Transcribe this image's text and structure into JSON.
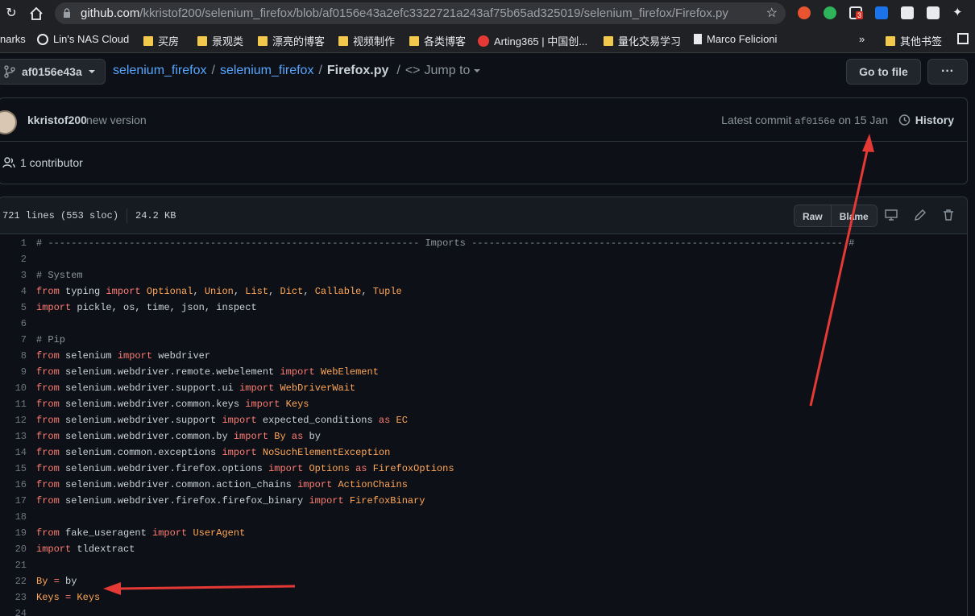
{
  "browser": {
    "url_host": "github.com",
    "url_path": "/kkristof200/selenium_firefox/blob/af0156e43a2efc3322721a243af75b65ad325019/selenium_firefox/Firefox.py",
    "ext_badge": "3",
    "bookmarks": [
      {
        "label": "narks",
        "type": "text"
      },
      {
        "label": "Lin's NAS Cloud",
        "type": "globe"
      },
      {
        "label": "买房",
        "type": "folder"
      },
      {
        "label": "景观类",
        "type": "folder"
      },
      {
        "label": "漂亮的博客",
        "type": "folder"
      },
      {
        "label": "视频制作",
        "type": "folder"
      },
      {
        "label": "各类博客",
        "type": "folder"
      },
      {
        "label": "Arting365 | 中国创...",
        "type": "site"
      },
      {
        "label": "量化交易学习",
        "type": "folder"
      },
      {
        "label": "Marco Felicioni",
        "type": "page"
      },
      {
        "label": "»",
        "type": "more"
      },
      {
        "label": "其他书签",
        "type": "folder"
      }
    ]
  },
  "repo": {
    "branch": "af0156e43a",
    "crumb_repo": "selenium_firefox",
    "crumb_dir": "selenium_firefox",
    "crumb_file": "Firefox.py",
    "jump_to": "Jump to",
    "go_to_file": "Go to file",
    "more": "···"
  },
  "commit": {
    "author": "kkristof200",
    "message": "new version",
    "latest_prefix": "Latest commit",
    "sha": "af0156e",
    "date": "on 15 Jan",
    "history": "History",
    "contributors": "1 contributor"
  },
  "file": {
    "lines_info": "721 lines (553 sloc)",
    "size": "24.2 KB",
    "raw": "Raw",
    "blame": "Blame"
  },
  "code_lines": [
    [
      [
        "cm",
        "# ---------------------------------------------------------------- Imports ---------------------------------------------------------------- #"
      ]
    ],
    [],
    [
      [
        "cm",
        "# System"
      ]
    ],
    [
      [
        "kw",
        "from"
      ],
      [
        "",
        " typing "
      ],
      [
        "kw",
        "import"
      ],
      [
        "",
        " "
      ],
      [
        "cls",
        "Optional"
      ],
      [
        "",
        ", "
      ],
      [
        "cls",
        "Union"
      ],
      [
        "",
        ", "
      ],
      [
        "cls",
        "List"
      ],
      [
        "",
        ", "
      ],
      [
        "cls",
        "Dict"
      ],
      [
        "",
        ", "
      ],
      [
        "cls",
        "Callable"
      ],
      [
        "",
        ", "
      ],
      [
        "cls",
        "Tuple"
      ]
    ],
    [
      [
        "kw",
        "import"
      ],
      [
        "",
        " pickle, os, time, json, inspect"
      ]
    ],
    [],
    [
      [
        "cm",
        "# Pip"
      ]
    ],
    [
      [
        "kw",
        "from"
      ],
      [
        "",
        " selenium "
      ],
      [
        "kw",
        "import"
      ],
      [
        "",
        " webdriver"
      ]
    ],
    [
      [
        "kw",
        "from"
      ],
      [
        "",
        " selenium.webdriver.remote.webelement "
      ],
      [
        "kw",
        "import"
      ],
      [
        "",
        " "
      ],
      [
        "cls",
        "WebElement"
      ]
    ],
    [
      [
        "kw",
        "from"
      ],
      [
        "",
        " selenium.webdriver.support.ui "
      ],
      [
        "kw",
        "import"
      ],
      [
        "",
        " "
      ],
      [
        "cls",
        "WebDriverWait"
      ]
    ],
    [
      [
        "kw",
        "from"
      ],
      [
        "",
        " selenium.webdriver.common.keys "
      ],
      [
        "kw",
        "import"
      ],
      [
        "",
        " "
      ],
      [
        "cls",
        "Keys"
      ]
    ],
    [
      [
        "kw",
        "from"
      ],
      [
        "",
        " selenium.webdriver.support "
      ],
      [
        "kw",
        "import"
      ],
      [
        "",
        " expected_conditions "
      ],
      [
        "kw",
        "as"
      ],
      [
        "",
        " "
      ],
      [
        "cls",
        "EC"
      ]
    ],
    [
      [
        "kw",
        "from"
      ],
      [
        "",
        " selenium.webdriver.common.by "
      ],
      [
        "kw",
        "import"
      ],
      [
        "",
        " "
      ],
      [
        "cls",
        "By"
      ],
      [
        "",
        " "
      ],
      [
        "kw",
        "as"
      ],
      [
        "",
        " by"
      ]
    ],
    [
      [
        "kw",
        "from"
      ],
      [
        "",
        " selenium.common.exceptions "
      ],
      [
        "kw",
        "import"
      ],
      [
        "",
        " "
      ],
      [
        "cls",
        "NoSuchElementException"
      ]
    ],
    [
      [
        "kw",
        "from"
      ],
      [
        "",
        " selenium.webdriver.firefox.options "
      ],
      [
        "kw",
        "import"
      ],
      [
        "",
        " "
      ],
      [
        "cls",
        "Options"
      ],
      [
        "",
        " "
      ],
      [
        "kw",
        "as"
      ],
      [
        "",
        " "
      ],
      [
        "cls",
        "FirefoxOptions"
      ]
    ],
    [
      [
        "kw",
        "from"
      ],
      [
        "",
        " selenium.webdriver.common.action_chains "
      ],
      [
        "kw",
        "import"
      ],
      [
        "",
        " "
      ],
      [
        "cls",
        "ActionChains"
      ]
    ],
    [
      [
        "kw",
        "from"
      ],
      [
        "",
        " selenium.webdriver.firefox.firefox_binary "
      ],
      [
        "kw",
        "import"
      ],
      [
        "",
        " "
      ],
      [
        "cls",
        "FirefoxBinary"
      ]
    ],
    [],
    [
      [
        "kw",
        "from"
      ],
      [
        "",
        " fake_useragent "
      ],
      [
        "kw",
        "import"
      ],
      [
        "",
        " "
      ],
      [
        "cls",
        "UserAgent"
      ]
    ],
    [
      [
        "kw",
        "import"
      ],
      [
        "",
        " tldextract"
      ]
    ],
    [],
    [
      [
        "cls",
        "By"
      ],
      [
        "",
        " "
      ],
      [
        "kw",
        "="
      ],
      [
        "",
        " by"
      ]
    ],
    [
      [
        "cls",
        "Keys"
      ],
      [
        "",
        " "
      ],
      [
        "kw",
        "="
      ],
      [
        "",
        " "
      ],
      [
        "cls",
        "Keys"
      ]
    ],
    []
  ]
}
